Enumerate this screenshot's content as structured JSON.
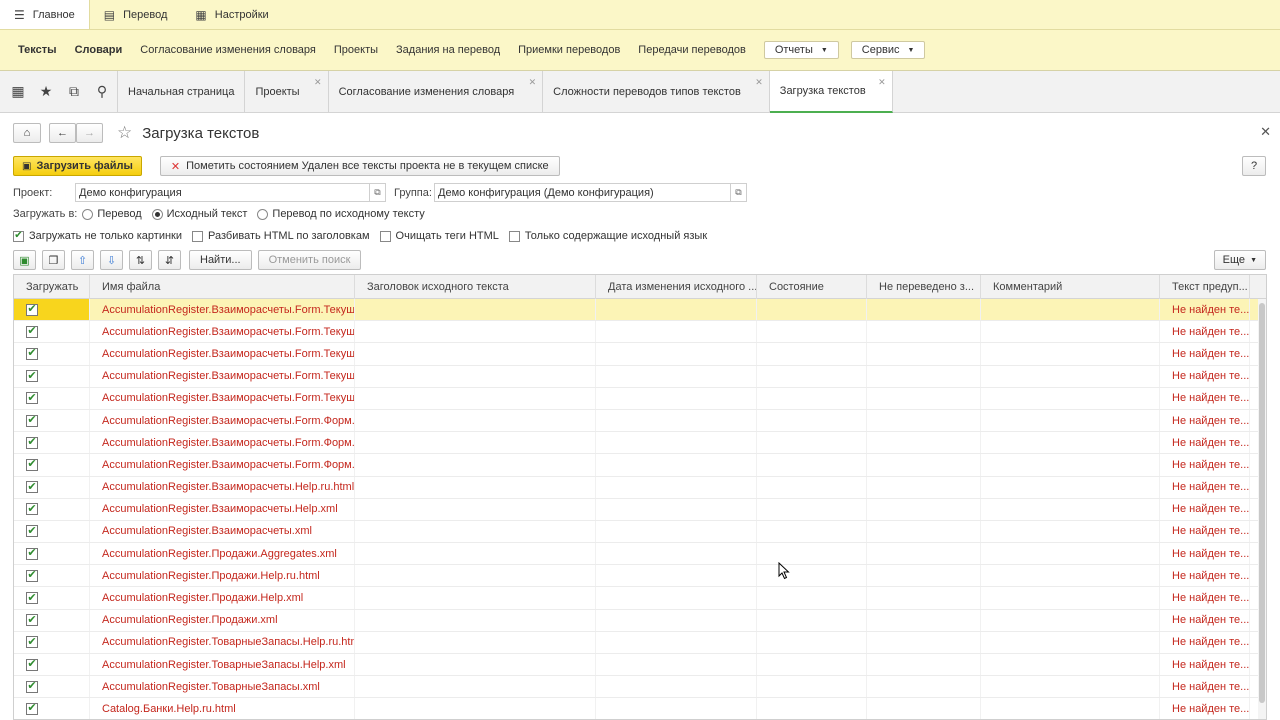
{
  "sections": [
    {
      "label": "Главное",
      "icon": "menu-icon",
      "glyph": "☰"
    },
    {
      "label": "Перевод",
      "icon": "document-icon",
      "glyph": "▤"
    },
    {
      "label": "Настройки",
      "icon": "settings-icon",
      "glyph": "▦"
    }
  ],
  "commands": {
    "items": [
      "Тексты",
      "Словари",
      "Согласование изменения словаря",
      "Проекты",
      "Задания на перевод",
      "Приемки переводов",
      "Передачи переводов"
    ],
    "reports": "Отчеты",
    "service": "Сервис"
  },
  "tabs": [
    "Начальная страница",
    "Проекты",
    "Согласование изменения словаря",
    "Сложности переводов типов текстов",
    "Загрузка текстов"
  ],
  "form": {
    "title": "Загрузка текстов",
    "load_button": "Загрузить файлы",
    "mark_button": "Пометить состоянием Удален все тексты проекта не в текущем списке",
    "help": "?",
    "project_label": "Проект:",
    "project_value": "Демо конфигурация",
    "group_label": "Группа:",
    "group_value": "Демо конфигурация (Демо конфигурация)",
    "load_to_label": "Загружать в:",
    "radios": [
      "Перевод",
      "Исходный текст",
      "Перевод по исходному тексту"
    ],
    "checks": [
      "Загружать не только картинки",
      "Разбивать HTML по заголовкам",
      "Очищать теги HTML",
      "Только содержащие исходный язык"
    ],
    "find_button": "Найти...",
    "cancel_search": "Отменить поиск",
    "more": "Еще"
  },
  "table": {
    "columns": [
      "Загружать",
      "Имя файла",
      "Заголовок исходного текста",
      "Дата изменения исходного ...",
      "Состояние",
      "Не переведено з...",
      "Комментарий",
      "Текст предуп..."
    ],
    "rows": [
      {
        "file": "AccumulationRegister.Взаиморасчеты.Form.Текущ...",
        "warn": "Не найден те..."
      },
      {
        "file": "AccumulationRegister.Взаиморасчеты.Form.Текущ...",
        "warn": "Не найден те..."
      },
      {
        "file": "AccumulationRegister.Взаиморасчеты.Form.Текущ...",
        "warn": "Не найден те..."
      },
      {
        "file": "AccumulationRegister.Взаиморасчеты.Form.Текущ...",
        "warn": "Не найден те..."
      },
      {
        "file": "AccumulationRegister.Взаиморасчеты.Form.Текущ...",
        "warn": "Не найден те..."
      },
      {
        "file": "AccumulationRegister.Взаиморасчеты.Form.Форм...",
        "warn": "Не найден те..."
      },
      {
        "file": "AccumulationRegister.Взаиморасчеты.Form.Форм...",
        "warn": "Не найден те..."
      },
      {
        "file": "AccumulationRegister.Взаиморасчеты.Form.Форм...",
        "warn": "Не найден те..."
      },
      {
        "file": "AccumulationRegister.Взаиморасчеты.Help.ru.html",
        "warn": "Не найден те..."
      },
      {
        "file": "AccumulationRegister.Взаиморасчеты.Help.xml",
        "warn": "Не найден те..."
      },
      {
        "file": "AccumulationRegister.Взаиморасчеты.xml",
        "warn": "Не найден те..."
      },
      {
        "file": "AccumulationRegister.Продажи.Aggregates.xml",
        "warn": "Не найден те..."
      },
      {
        "file": "AccumulationRegister.Продажи.Help.ru.html",
        "warn": "Не найден те..."
      },
      {
        "file": "AccumulationRegister.Продажи.Help.xml",
        "warn": "Не найден те..."
      },
      {
        "file": "AccumulationRegister.Продажи.xml",
        "warn": "Не найден те..."
      },
      {
        "file": "AccumulationRegister.ТоварныеЗапасы.Help.ru.html",
        "warn": "Не найден те..."
      },
      {
        "file": "AccumulationRegister.ТоварныеЗапасы.Help.xml",
        "warn": "Не найден те..."
      },
      {
        "file": "AccumulationRegister.ТоварныеЗапасы.xml",
        "warn": "Не найден те..."
      },
      {
        "file": "Catalog.Банки.Help.ru.html",
        "warn": "Не найден те..."
      }
    ]
  }
}
